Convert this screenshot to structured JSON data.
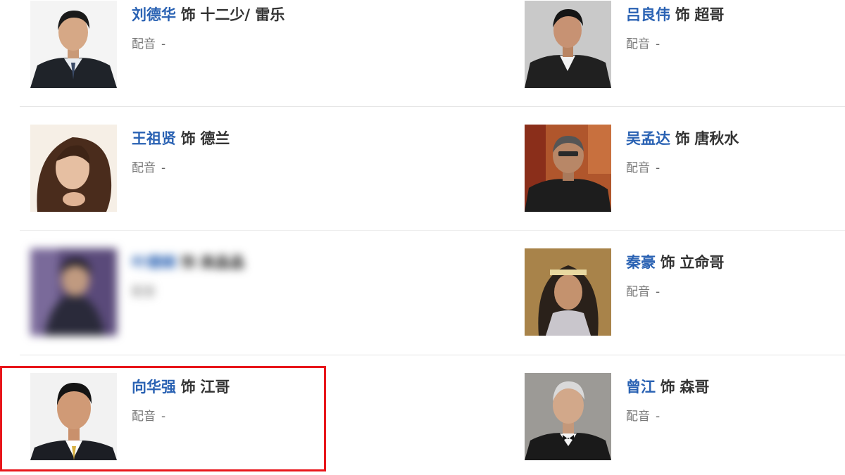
{
  "cast": [
    {
      "actor": "刘德华",
      "sep": "饰",
      "role": "十二少/ 雷乐",
      "dub_label": "配音",
      "dub_value": "-"
    },
    {
      "actor": "吕良伟",
      "sep": "饰",
      "role": "超哥",
      "dub_label": "配音",
      "dub_value": "-"
    },
    {
      "actor": "王祖贤",
      "sep": "饰",
      "role": "德兰",
      "dub_label": "配音",
      "dub_value": "-"
    },
    {
      "actor": "吴孟达",
      "sep": "饰",
      "role": "唐秋水",
      "dub_label": "配音",
      "dub_value": "-"
    },
    {
      "actor": "叶德娴",
      "sep": "饰",
      "role": "高晶晶",
      "dub_label": "配音",
      "dub_value": "-",
      "blurred": true
    },
    {
      "actor": "秦豪",
      "sep": "饰",
      "role": "立命哥",
      "dub_label": "配音",
      "dub_value": "-"
    },
    {
      "actor": "向华强",
      "sep": "饰",
      "role": "江哥",
      "dub_label": "配音",
      "dub_value": "-",
      "highlighted": true
    },
    {
      "actor": "曾江",
      "sep": "饰",
      "role": "森哥",
      "dub_label": "配音",
      "dub_value": "-"
    }
  ],
  "colors": {
    "link": "#2a62b3",
    "text": "#333333",
    "muted": "#666666",
    "highlight": "#e8161b",
    "divider": "#e4e4e4"
  }
}
